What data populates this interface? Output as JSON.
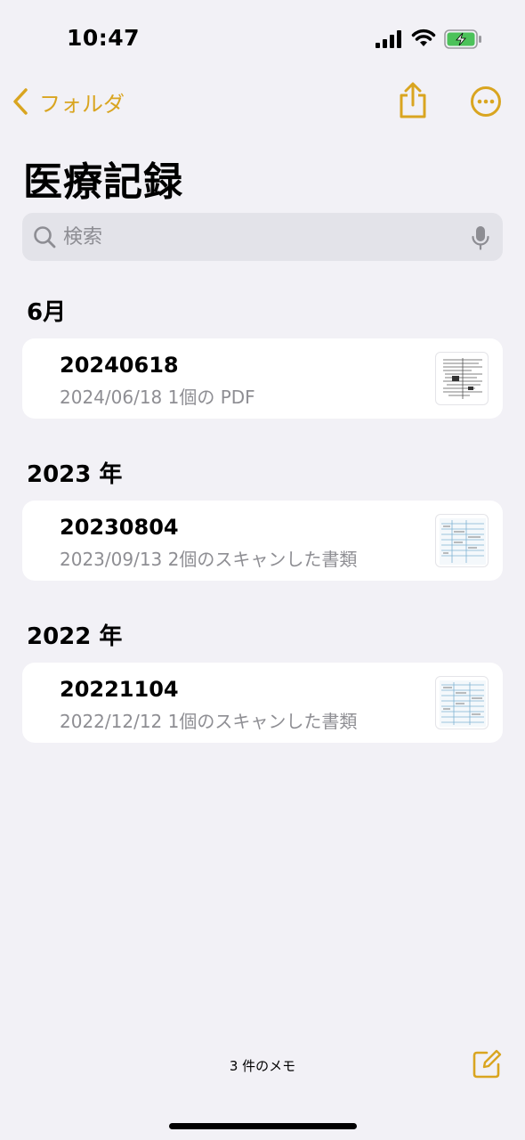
{
  "status_bar": {
    "time": "10:47"
  },
  "nav": {
    "back_label": "フォルダ"
  },
  "page_title": "医療記録",
  "search": {
    "placeholder": "検索"
  },
  "sections": [
    {
      "header": "6月",
      "notes": [
        {
          "title": "20240618",
          "subtitle": "2024/06/18  1個の PDF",
          "thumbnail": "pdf-thumbnail"
        }
      ]
    },
    {
      "header": "2023 年",
      "notes": [
        {
          "title": "20230804",
          "subtitle": "2023/09/13  2個のスキャンした書類",
          "thumbnail": "scan-thumbnail"
        }
      ]
    },
    {
      "header": "2022 年",
      "notes": [
        {
          "title": "20221104",
          "subtitle": "2022/12/12  1個のスキャンした書類",
          "thumbnail": "scan-thumbnail"
        }
      ]
    }
  ],
  "footer": {
    "note_count": "3 件のメモ"
  },
  "colors": {
    "accent": "#d9a520",
    "background": "#f2f1f6",
    "secondary_text": "#8e8e93"
  },
  "icons": [
    "signal-icon",
    "wifi-icon",
    "battery-charging-icon",
    "chevron-left-icon",
    "share-icon",
    "more-icon",
    "search-icon",
    "mic-icon",
    "compose-icon"
  ]
}
